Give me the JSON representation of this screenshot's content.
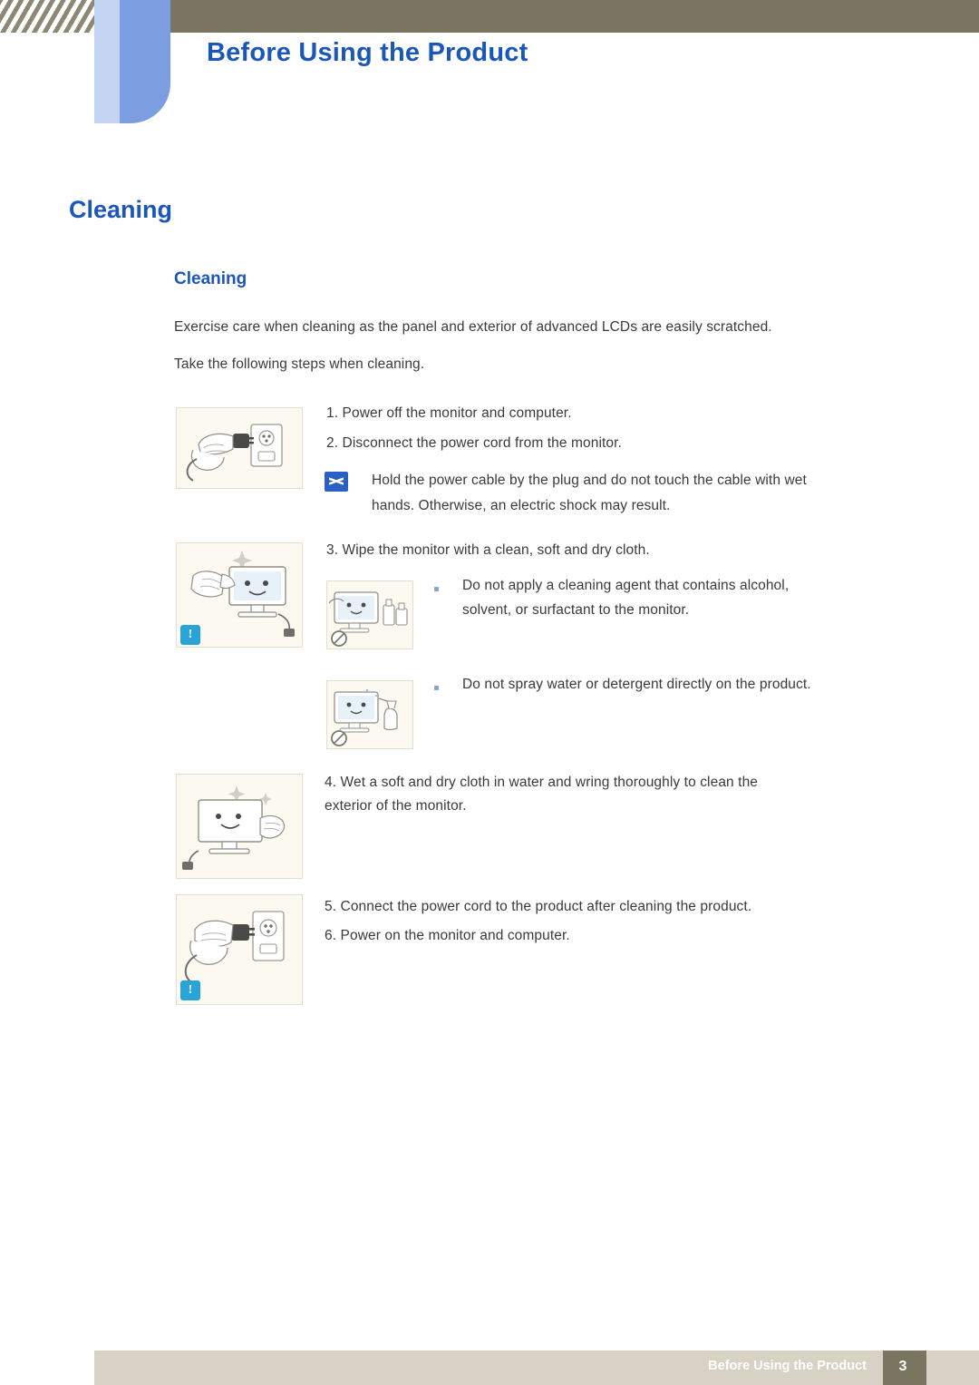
{
  "header": {
    "title": "Before Using the Product"
  },
  "chapter_title": "Cleaning",
  "section_title": "Cleaning",
  "intro": {
    "line1": "Exercise care when cleaning as the panel and exterior of advanced LCDs are easily scratched.",
    "line2": "Take the following steps when cleaning."
  },
  "steps": {
    "step1": "1. Power off the monitor and computer.",
    "step2": "2. Disconnect the power cord from the monitor.",
    "note1_line1": "Hold the power cable by the plug and do not touch the cable with wet",
    "note1_line2": "hands. Otherwise, an electric shock may result.",
    "step3": "3. Wipe the monitor with a clean, soft and dry cloth.",
    "bullet1_line1": "Do not apply a cleaning agent that contains alcohol,",
    "bullet1_line2": "solvent, or surfactant to the monitor.",
    "bullet2": "Do not spray water or detergent directly on the product.",
    "step4_line1": "4. Wet a soft and dry cloth in water and wring thoroughly to clean the",
    "step4_line2": "exterior of the monitor.",
    "step5": "5. Connect the power cord to the product after cleaning the product.",
    "step6": "6. Power on the monitor and computer."
  },
  "badges": {
    "exclamation": "!"
  },
  "footer": {
    "text": "Before Using the Product",
    "page": "3"
  },
  "colors": {
    "accent_blue": "#1b57b8",
    "header_band": "#7a7560",
    "tab_blue": "#7c9ee0",
    "footer_band": "#d8d2c4",
    "badge_blue": "#2aa3d8"
  }
}
